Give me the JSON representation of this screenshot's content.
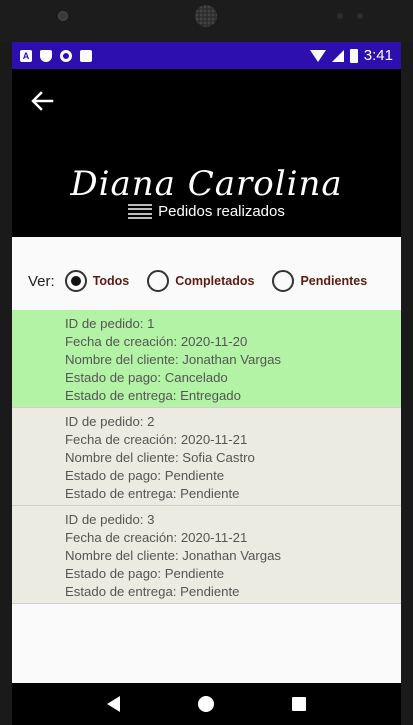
{
  "status_bar": {
    "time": "3:41",
    "left_icons": [
      "a-icon",
      "shield-icon",
      "circle-icon",
      "sd-card-icon"
    ],
    "right_icons": [
      "wifi-icon",
      "signal-icon",
      "battery-icon"
    ]
  },
  "header": {
    "brand": "Diana Carolina",
    "subtitle": "Pedidos realizados",
    "back_icon": "arrow-left-icon",
    "bg_color": "#000000"
  },
  "filter": {
    "label": "Ver:",
    "options": [
      {
        "label": "Todos",
        "checked": true
      },
      {
        "label": "Completados",
        "checked": false
      },
      {
        "label": "Pendientes",
        "checked": false
      }
    ],
    "label_color": "#5a1c10"
  },
  "orders": [
    {
      "bg": "#b3f3a6",
      "id_line": "ID de pedido: 1",
      "date_line": "Fecha de creación: 2020-11-20",
      "client_line": "Nombre del cliente: Jonathan Vargas",
      "payment_line": "Estado de pago: Cancelado",
      "delivery_line": "Estado de entrega: Entregado"
    },
    {
      "bg": "#ecebe2",
      "id_line": "ID de pedido: 2",
      "date_line": "Fecha de creación: 2020-11-21",
      "client_line": "Nombre del cliente: Sofia Castro",
      "payment_line": "Estado de pago: Pendiente",
      "delivery_line": "Estado de entrega: Pendiente"
    },
    {
      "bg": "#ecebe2",
      "id_line": "ID de pedido: 3",
      "date_line": "Fecha de creación: 2020-11-21",
      "client_line": "Nombre del cliente: Jonathan Vargas",
      "payment_line": "Estado de pago: Pendiente",
      "delivery_line": "Estado de entrega: Pendiente"
    }
  ],
  "colors": {
    "status_bar": "#2d0fb0",
    "completed_order": "#b3f3a6",
    "pending_order": "#ecebe2"
  }
}
